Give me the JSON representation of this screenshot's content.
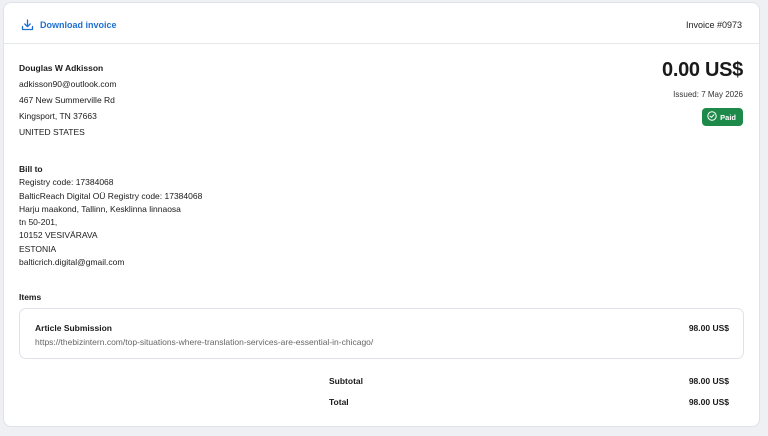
{
  "header": {
    "download_label": "Download invoice",
    "invoice_number": "Invoice #0973"
  },
  "seller": {
    "name": "Douglas W Adkisson",
    "email": "adkisson90@outlook.com",
    "address1": "467 New Summerville Rd",
    "address2": "Kingsport, TN 37663",
    "country": "UNITED STATES"
  },
  "summary": {
    "amount": "0.00 US$",
    "issued": "Issued: 7 May 2026",
    "status": "Paid",
    "status_color": "#1e8a4a"
  },
  "bill_to": {
    "heading": "Bill to",
    "lines": [
      "Registry code: 17384068",
      "BalticReach Digital OÜ Registry code: 17384068",
      "Harju maakond, Tallinn, Kesklinna linnaosa",
      "tn 50-201,",
      "10152 VESIVÄRAVA",
      "ESTONIA",
      "balticrich.digital@gmail.com"
    ]
  },
  "items": {
    "heading": "Items",
    "list": [
      {
        "title": "Article Submission",
        "url": "https://thebizintern.com/top-situations-where-translation-services-are-essential-in-chicago/",
        "price": "98.00 US$"
      }
    ]
  },
  "totals": {
    "subtotal_label": "Subtotal",
    "subtotal_value": "98.00 US$",
    "total_label": "Total",
    "total_value": "98.00 US$"
  },
  "icons": {
    "download": "download-icon",
    "paid": "check-circle-icon"
  },
  "colors": {
    "link": "#1f6fd1",
    "paid_badge": "#1e8a4a"
  }
}
